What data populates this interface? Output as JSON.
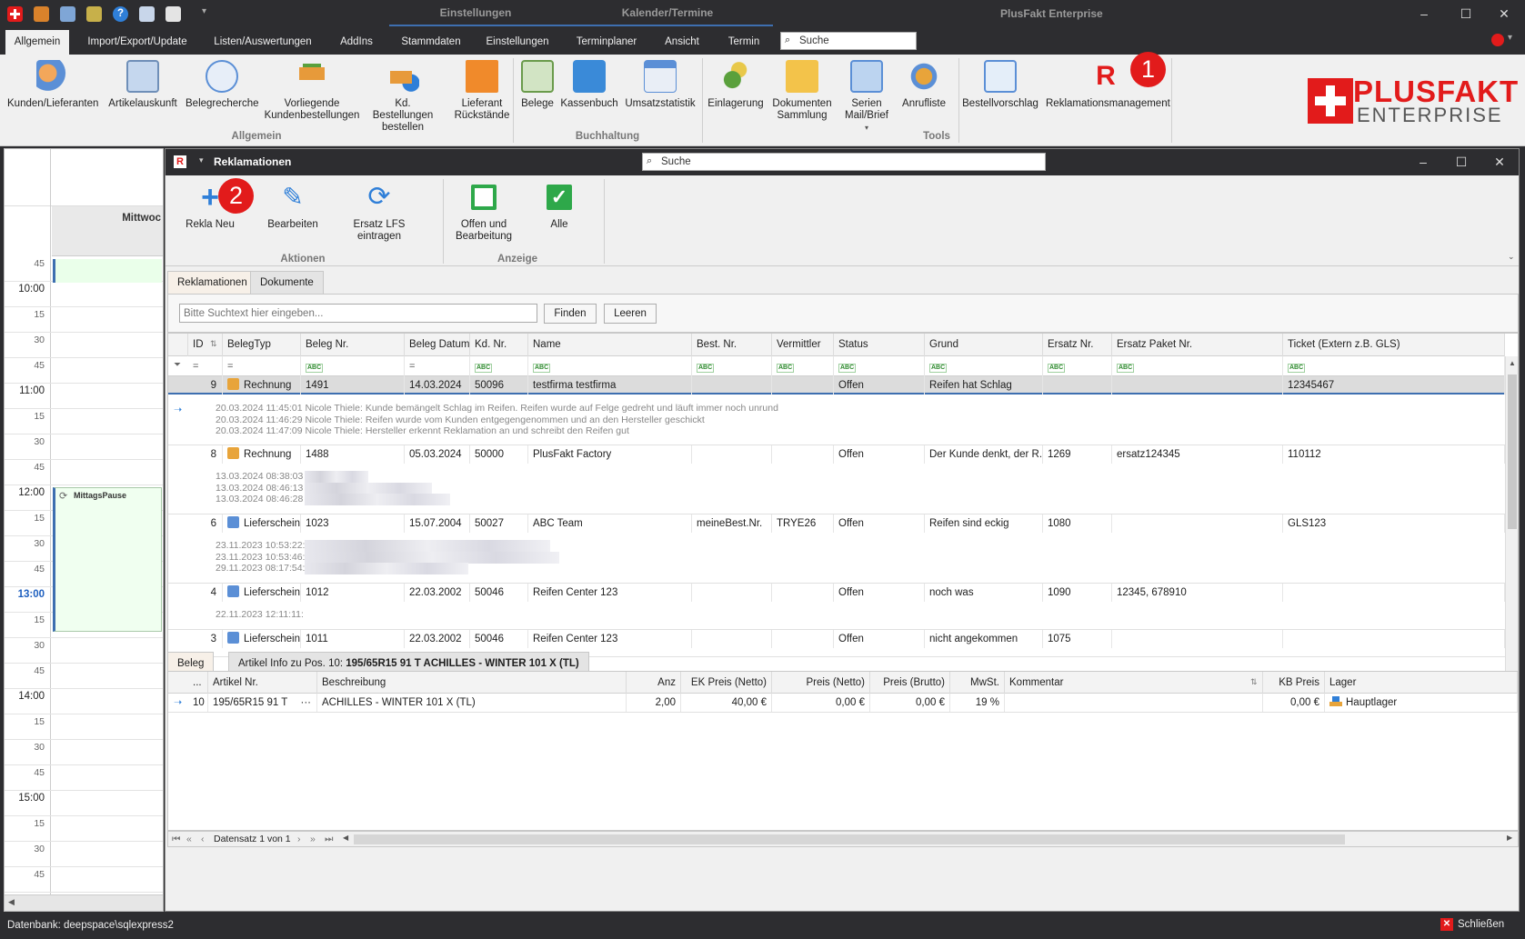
{
  "titlebar": {
    "app_title": "PlusFakt Enterprise",
    "context_tabs": [
      "Einstellungen",
      "Kalender/Termine"
    ]
  },
  "menu": {
    "tabs": [
      "Allgemein",
      "Import/Export/Update",
      "Listen/Auswertungen",
      "AddIns",
      "Stammdaten",
      "Einstellungen",
      "Terminplaner",
      "Ansicht",
      "Termin"
    ],
    "search_placeholder": "Suche"
  },
  "ribbon": {
    "buttons": [
      {
        "label": "Kunden/Lieferanten",
        "icon": "customers-icon"
      },
      {
        "label": "Artikelauskunft",
        "icon": "article-icon"
      },
      {
        "label": "Belegrecherche",
        "icon": "document-search-icon"
      },
      {
        "label": "Vorliegende Kundenbestellungen",
        "icon": "cart-icon"
      },
      {
        "label": "Kd. Bestellungen bestellen",
        "icon": "cart-add-icon"
      },
      {
        "label": "Lieferant Rückstände",
        "icon": "supplier-backlog-icon"
      },
      {
        "label": "Belege",
        "icon": "receipts-icon"
      },
      {
        "label": "Kassenbuch",
        "icon": "cash-register-icon"
      },
      {
        "label": "Umsatzstatistik",
        "icon": "statistics-icon"
      },
      {
        "label": "Einlagerung",
        "icon": "storage-icon"
      },
      {
        "label": "Dokumenten Sammlung",
        "icon": "folder-icon"
      },
      {
        "label": "Serien Mail/Brief",
        "icon": "mail-icon"
      },
      {
        "label": "Anrufliste",
        "icon": "call-list-icon"
      },
      {
        "label": "Bestellvorschlag",
        "icon": "order-suggestion-icon"
      },
      {
        "label": "Reklamationsmanagement",
        "icon": "complaint-icon"
      }
    ],
    "groups": [
      "Allgemein",
      "Buchhaltung",
      "Tools"
    ],
    "logo_line1": "PLUSFAKT",
    "logo_line2": "ENTERPRISE",
    "badge1": "1"
  },
  "calendar": {
    "day_header": "Mittwoc",
    "slots": [
      "45",
      "10:00",
      "15",
      "30",
      "45",
      "11:00",
      "15",
      "30",
      "45",
      "12:00",
      "15",
      "30",
      "45",
      "13:00",
      "15",
      "30",
      "45",
      "14:00",
      "15",
      "30",
      "45",
      "15:00",
      "15",
      "30",
      "45"
    ],
    "appointment": "MittagsPause"
  },
  "rekla": {
    "title": "Reklamationen",
    "search_placeholder": "Suche",
    "actions": [
      {
        "label": "Rekla Neu"
      },
      {
        "label": "Bearbeiten"
      },
      {
        "label": "Ersatz LFS eintragen"
      },
      {
        "label": "Offen und Bearbeitung"
      },
      {
        "label": "Alle"
      }
    ],
    "group_actions": "Aktionen",
    "group_view": "Anzeige",
    "badge2": "2",
    "subtabs": [
      "Reklamationen",
      "Dokumente"
    ],
    "filter_placeholder": "Bitte Suchtext hier eingeben...",
    "find_label": "Finden",
    "clear_label": "Leeren",
    "columns": [
      "ID",
      "BelegTyp",
      "Beleg Nr.",
      "Beleg Datum",
      "Kd. Nr.",
      "Name",
      "Best. Nr.",
      "Vermittler",
      "Status",
      "Grund",
      "Ersatz Nr.",
      "Ersatz Paket Nr.",
      "Ticket (Extern z.B. GLS)"
    ],
    "rows": [
      {
        "id": "9",
        "typ": "Rechnung",
        "nr": "1491",
        "datum": "14.03.2024",
        "kd": "50096",
        "name": "testfirma testfirma",
        "best": "",
        "verm": "",
        "status": "Offen",
        "grund": "Reifen hat Schlag",
        "ersatz": "",
        "paket": "",
        "ticket": "12345467",
        "notes": [
          "20.03.2024 11:45:01 Nicole Thiele: Kunde bemängelt Schlag im Reifen. Reifen wurde auf Felge gedreht und läuft immer noch unrund",
          "20.03.2024 11:46:29 Nicole Thiele: Reifen wurde vom Kunden entgegengenommen und an den Hersteller geschickt",
          "20.03.2024 11:47:09 Nicole Thiele: Hersteller erkennt Reklamation an und schreibt den Reifen gut"
        ]
      },
      {
        "id": "8",
        "typ": "Rechnung",
        "nr": "1488",
        "datum": "05.03.2024",
        "kd": "50000",
        "name": "PlusFakt Factory",
        "best": "",
        "verm": "",
        "status": "Offen",
        "grund": "Der Kunde denkt, der R...",
        "ersatz": "1269",
        "paket": "ersatz124345",
        "ticket": "110112",
        "notes": [
          "13.03.2024 08:38:03",
          "13.03.2024 08:46:13",
          "13.03.2024 08:46:28"
        ]
      },
      {
        "id": "6",
        "typ": "Lieferschein",
        "nr": "1023",
        "datum": "15.07.2004",
        "kd": "50027",
        "name": "ABC Team",
        "best": "meineBest.Nr.",
        "verm": "TRYE26",
        "status": "Offen",
        "grund": "Reifen sind eckig",
        "ersatz": "1080",
        "paket": "",
        "ticket": "GLS123",
        "notes": [
          "23.11.2023 10:53:22:",
          "23.11.2023 10:53:46:",
          "29.11.2023 08:17:54:"
        ]
      },
      {
        "id": "4",
        "typ": "Lieferschein",
        "nr": "1012",
        "datum": "22.03.2002",
        "kd": "50046",
        "name": "Reifen Center 123",
        "best": "",
        "verm": "",
        "status": "Offen",
        "grund": "noch was",
        "ersatz": "1090",
        "paket": "12345, 678910",
        "ticket": "",
        "notes": [
          "22.11.2023 12:11:11:"
        ]
      },
      {
        "id": "3",
        "typ": "Lieferschein",
        "nr": "1011",
        "datum": "22.03.2002",
        "kd": "50046",
        "name": "Reifen Center 123",
        "best": "",
        "verm": "",
        "status": "Offen",
        "grund": "nicht angekommen",
        "ersatz": "1075",
        "paket": "",
        "ticket": "",
        "notes": []
      }
    ],
    "bottom_tabs": [
      "Beleg Pos.",
      "Artikel Info zu Pos. 10:"
    ],
    "bottom_tab_article": "195/65R15 91 T ACHILLES - WINTER 101 X (TL)",
    "pos_columns": [
      "...",
      "Artikel Nr.",
      "Beschreibung",
      "Anz",
      "EK Preis (Netto)",
      "Preis (Netto)",
      "Preis (Brutto)",
      "MwSt.",
      "Kommentar",
      "KB Preis",
      "Lager"
    ],
    "pos_row": {
      "pos": "10",
      "artikel": "195/65R15 91 T",
      "more": "···",
      "beschreibung": "ACHILLES - WINTER 101 X (TL)",
      "anz": "2,00",
      "ek": "40,00 €",
      "netto": "0,00 €",
      "brutto": "0,00 €",
      "mwst": "19 %",
      "kommentar": "",
      "kb": "0,00 €",
      "lager": "Hauptlager"
    },
    "navigator": "Datensatz 1 von 1"
  },
  "status": {
    "db": "Datenbank: deepspace\\sqlexpress2",
    "close": "Schließen"
  },
  "colors": {
    "accent": "#3e6fb0",
    "badge": "#e21b1b",
    "dark": "#2d2d30",
    "selected_row": "#dcdcdc",
    "appointment": "#f0fff0"
  }
}
